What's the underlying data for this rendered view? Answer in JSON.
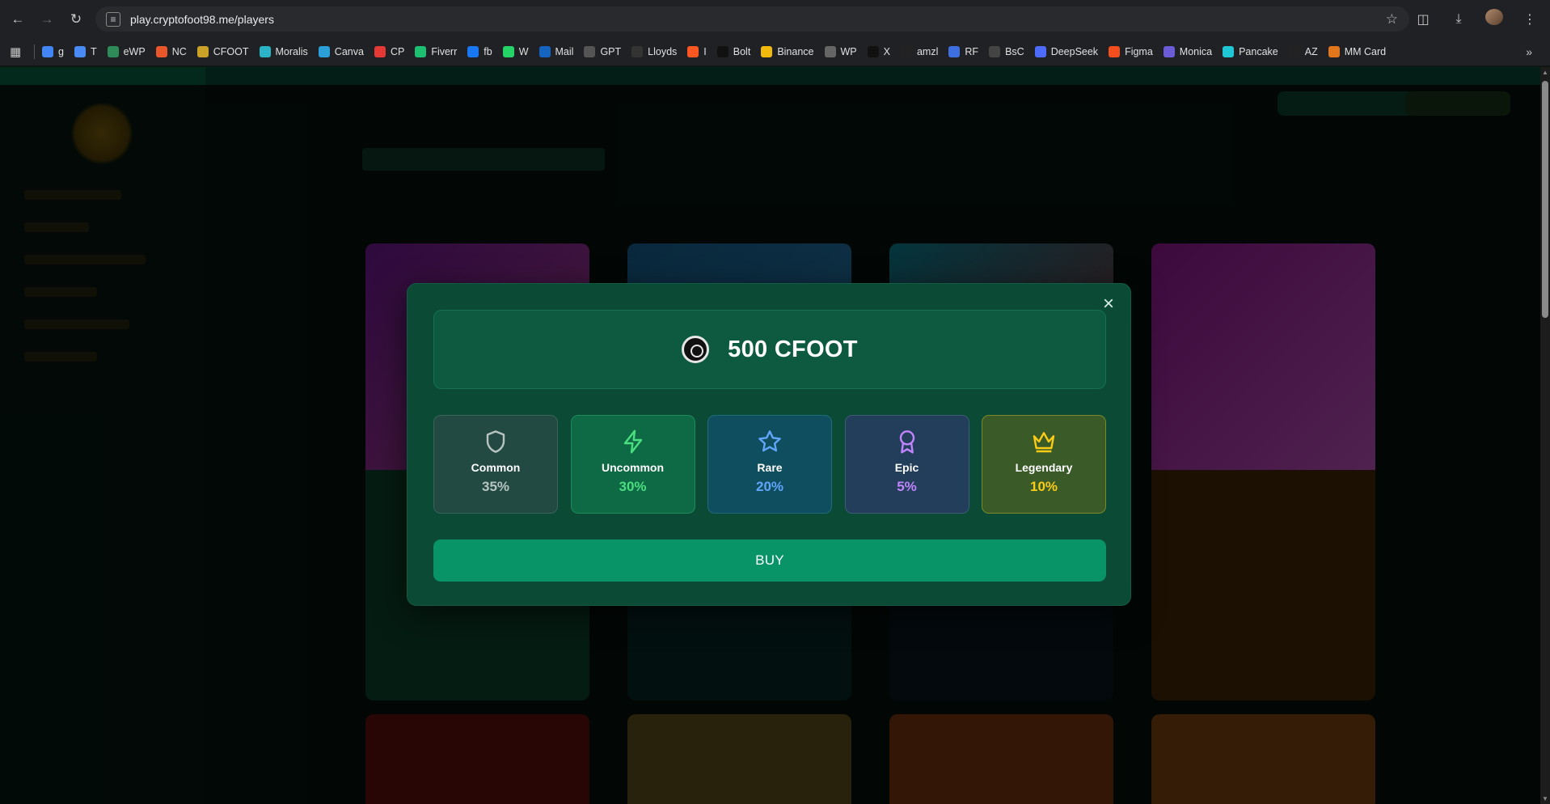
{
  "browser": {
    "url": "play.cryptofoot98.me/players",
    "bookmarks": [
      {
        "label": "g",
        "color": "#4285f4"
      },
      {
        "label": "T",
        "color": "#4a8af4"
      },
      {
        "label": "eWP",
        "color": "#2e8b57"
      },
      {
        "label": "NC",
        "color": "#e8562a"
      },
      {
        "label": "CFOOT",
        "color": "#c9a227"
      },
      {
        "label": "Moralis",
        "color": "#2bb3c8"
      },
      {
        "label": "Canva",
        "color": "#2a9fd8"
      },
      {
        "label": "CP",
        "color": "#e53935"
      },
      {
        "label": "Fiverr",
        "color": "#1dbf73"
      },
      {
        "label": "fb",
        "color": "#1877f2"
      },
      {
        "label": "W",
        "color": "#25d366"
      },
      {
        "label": "Mail",
        "color": "#1565c0"
      },
      {
        "label": "GPT",
        "color": "#555555"
      },
      {
        "label": "Lloyds",
        "color": "#333333"
      },
      {
        "label": "I",
        "color": "#ff5722"
      },
      {
        "label": "Bolt",
        "color": "#111111"
      },
      {
        "label": "Binance",
        "color": "#f0b90b"
      },
      {
        "label": "WP",
        "color": "#666666"
      },
      {
        "label": "X",
        "color": "#111111"
      },
      {
        "label": "amzl",
        "color": "#222222"
      },
      {
        "label": "RF",
        "color": "#3d6fe0"
      },
      {
        "label": "BsC",
        "color": "#444444"
      },
      {
        "label": "DeepSeek",
        "color": "#4d6bfe"
      },
      {
        "label": "Figma",
        "color": "#f24e1e"
      },
      {
        "label": "Monica",
        "color": "#6b5bd6"
      },
      {
        "label": "Pancake",
        "color": "#1fc7d4"
      },
      {
        "label": "AZ",
        "color": "#222222"
      },
      {
        "label": "MM Card",
        "color": "#e2761b"
      }
    ]
  },
  "modal": {
    "price": "500 CFOOT",
    "tiers": [
      {
        "name": "Common",
        "pct": "35%",
        "color": "#b8c4c0",
        "icon": "shield-icon"
      },
      {
        "name": "Uncommon",
        "pct": "30%",
        "color": "#4ade80",
        "icon": "lightning-icon"
      },
      {
        "name": "Rare",
        "pct": "20%",
        "color": "#60a5fa",
        "icon": "star-icon"
      },
      {
        "name": "Epic",
        "pct": "5%",
        "color": "#c084fc",
        "icon": "award-icon"
      },
      {
        "name": "Legendary",
        "pct": "10%",
        "color": "#facc15",
        "icon": "crown-icon"
      }
    ],
    "buy_label": "BUY"
  }
}
